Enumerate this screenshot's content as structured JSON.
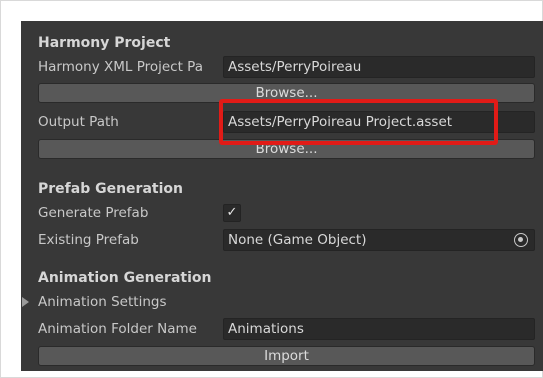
{
  "harmony_project": {
    "section_title": "Harmony Project",
    "xml_path_label": "Harmony XML Project Pa",
    "xml_path_value": "Assets/PerryPoireau",
    "browse_label_1": "Browse...",
    "output_path_label": "Output Path",
    "output_path_value": "Assets/PerryPoireau Project.asset",
    "browse_label_2": "Browse..."
  },
  "prefab_generation": {
    "section_title": "Prefab Generation",
    "generate_prefab_label": "Generate Prefab",
    "generate_prefab_checked": "✓",
    "existing_prefab_label": "Existing Prefab",
    "existing_prefab_value": "None (Game Object)"
  },
  "animation_generation": {
    "section_title": "Animation Generation",
    "animation_settings_label": "Animation Settings",
    "animation_folder_label": "Animation Folder Name",
    "animation_folder_value": "Animations"
  },
  "import_button_label": "Import",
  "icons": {
    "object_picker": "object-picker-icon",
    "foldout": "foldout-arrow-icon",
    "checkmark": "checkmark-icon"
  },
  "colors": {
    "panel_bg": "#383838",
    "field_bg": "#2a2a2a",
    "button_bg": "#585858",
    "highlight": "#e11b17"
  }
}
